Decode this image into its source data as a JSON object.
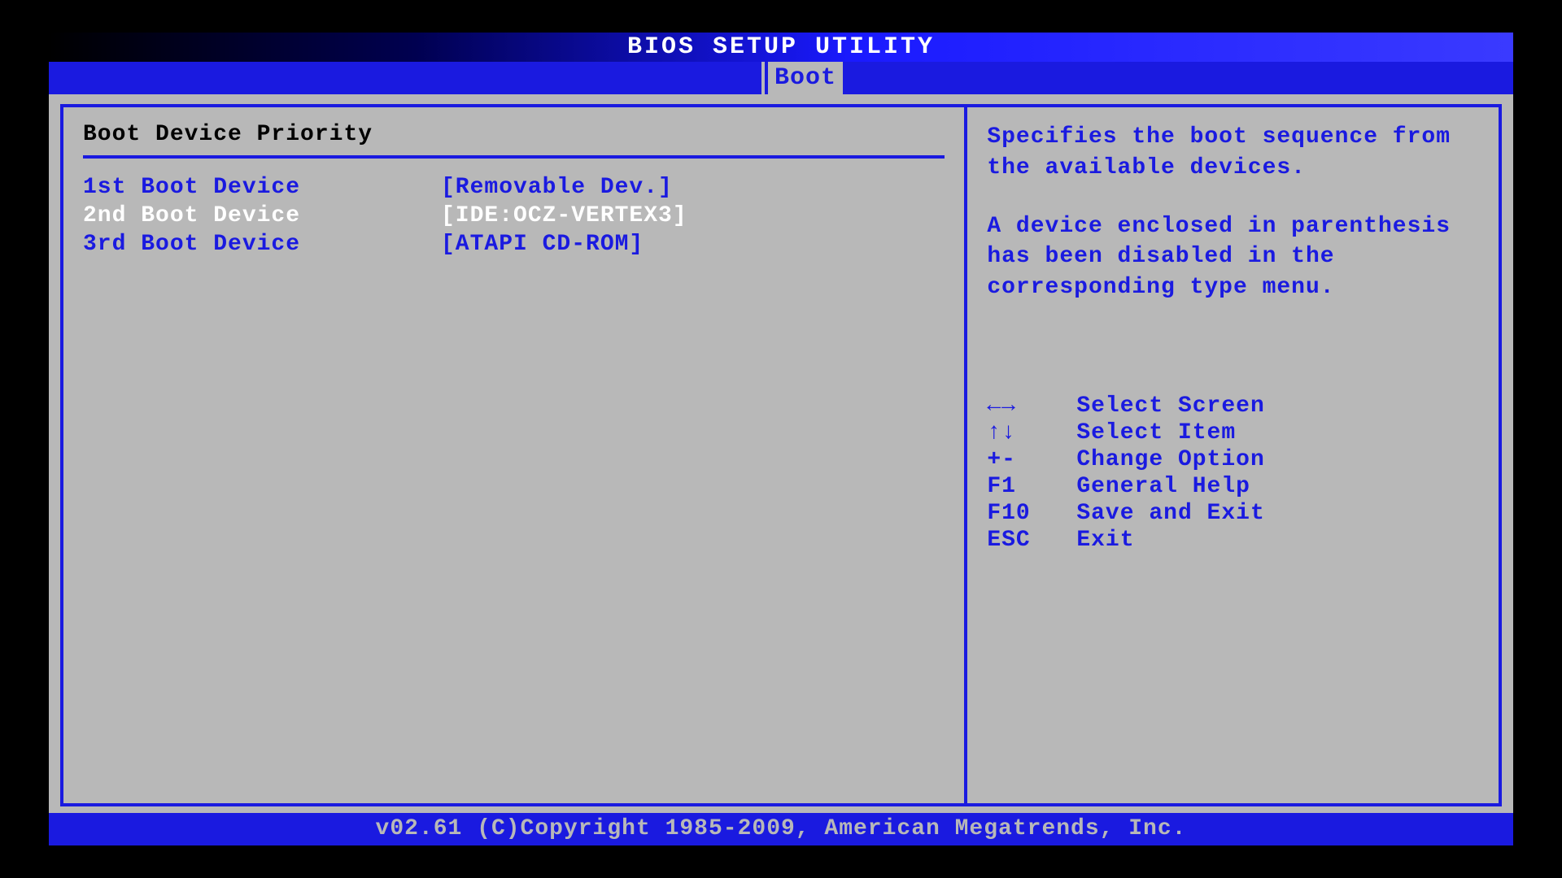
{
  "title": "BIOS SETUP UTILITY",
  "active_tab": "Boot",
  "section_title": "Boot Device Priority",
  "boot_items": [
    {
      "label": "1st Boot Device",
      "value": "[Removable Dev.]",
      "selected": false
    },
    {
      "label": "2nd Boot Device",
      "value": "[IDE:OCZ-VERTEX3]",
      "selected": true
    },
    {
      "label": "3rd Boot Device",
      "value": "[ATAPI CD-ROM]",
      "selected": false
    }
  ],
  "help": {
    "para1": "Specifies the boot sequence from the available devices.",
    "para2": "A device enclosed in parenthesis has been disabled in the corresponding type menu."
  },
  "keys": [
    {
      "k": "←→",
      "d": "Select Screen"
    },
    {
      "k": "↑↓",
      "d": "Select Item"
    },
    {
      "k": "+-",
      "d": "Change Option"
    },
    {
      "k": "F1",
      "d": "General Help"
    },
    {
      "k": "F10",
      "d": "Save and Exit"
    },
    {
      "k": "ESC",
      "d": "Exit"
    }
  ],
  "footer": "v02.61 (C)Copyright 1985-2009, American Megatrends, Inc."
}
